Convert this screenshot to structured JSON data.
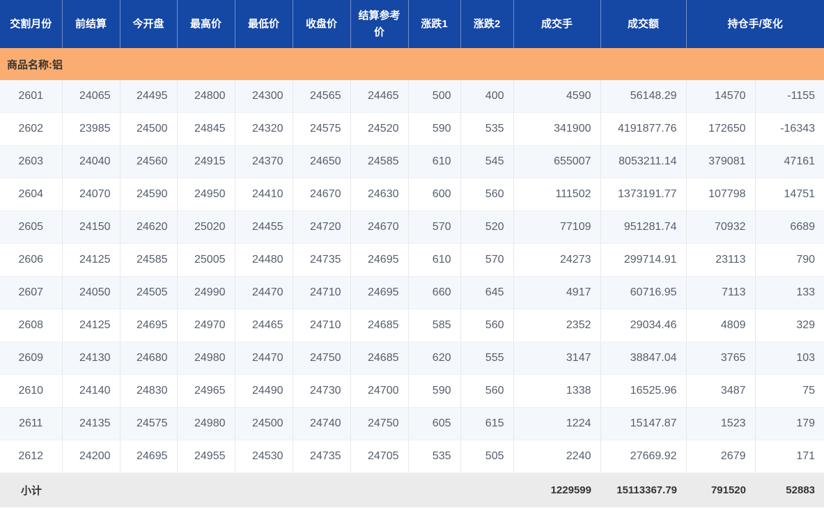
{
  "table": {
    "header": [
      "交割月份",
      "前结算",
      "今开盘",
      "最高价",
      "最低价",
      "收盘价",
      "结算参考价",
      "涨跌1",
      "涨跌2",
      "成交手",
      "成交额",
      "持仓手/变化"
    ],
    "group_label": "商品名称:铝",
    "rows": [
      [
        "2601",
        "24065",
        "24495",
        "24800",
        "24300",
        "24565",
        "24465",
        "500",
        "400",
        "4590",
        "56148.29",
        "14570",
        "-1155"
      ],
      [
        "2602",
        "23985",
        "24500",
        "24845",
        "24320",
        "24575",
        "24520",
        "590",
        "535",
        "341900",
        "4191877.76",
        "172650",
        "-16343"
      ],
      [
        "2603",
        "24040",
        "24560",
        "24915",
        "24370",
        "24650",
        "24585",
        "610",
        "545",
        "655007",
        "8053211.14",
        "379081",
        "47161"
      ],
      [
        "2604",
        "24070",
        "24590",
        "24950",
        "24410",
        "24670",
        "24630",
        "600",
        "560",
        "111502",
        "1373191.77",
        "107798",
        "14751"
      ],
      [
        "2605",
        "24150",
        "24620",
        "25020",
        "24455",
        "24720",
        "24670",
        "570",
        "520",
        "77109",
        "951281.74",
        "70932",
        "6689"
      ],
      [
        "2606",
        "24125",
        "24585",
        "25005",
        "24480",
        "24735",
        "24695",
        "610",
        "570",
        "24273",
        "299714.91",
        "23113",
        "790"
      ],
      [
        "2607",
        "24050",
        "24505",
        "24990",
        "24470",
        "24710",
        "24695",
        "660",
        "645",
        "4917",
        "60716.95",
        "7113",
        "133"
      ],
      [
        "2608",
        "24125",
        "24695",
        "24970",
        "24465",
        "24710",
        "24685",
        "585",
        "560",
        "2352",
        "29034.46",
        "4809",
        "329"
      ],
      [
        "2609",
        "24130",
        "24680",
        "24980",
        "24470",
        "24750",
        "24685",
        "620",
        "555",
        "3147",
        "38847.04",
        "3765",
        "103"
      ],
      [
        "2610",
        "24140",
        "24830",
        "24965",
        "24490",
        "24730",
        "24700",
        "590",
        "560",
        "1338",
        "16525.96",
        "3487",
        "75"
      ],
      [
        "2611",
        "24135",
        "24575",
        "24980",
        "24500",
        "24740",
        "24750",
        "605",
        "615",
        "1224",
        "15147.87",
        "1523",
        "179"
      ],
      [
        "2612",
        "24200",
        "24695",
        "24955",
        "24530",
        "24735",
        "24705",
        "535",
        "505",
        "2240",
        "27669.92",
        "2679",
        "171"
      ]
    ],
    "subtotal_row": [
      "小计",
      "",
      "",
      "",
      "",
      "",
      "",
      "",
      "",
      "1229599",
      "15113367.79",
      "791520",
      "52883"
    ]
  },
  "theme": {
    "header_bg": "#1547A5",
    "header_text": "#FFFFFF",
    "group_row_bg": "#FBAD71",
    "alt_row_bg": "#F4F7FB",
    "row_bg": "#FFFFFF",
    "subtotal_bg": "#EBEBEB",
    "data_text": "#555E6C",
    "strong_text": "#333333",
    "grid_line": "#E8E8E8"
  }
}
